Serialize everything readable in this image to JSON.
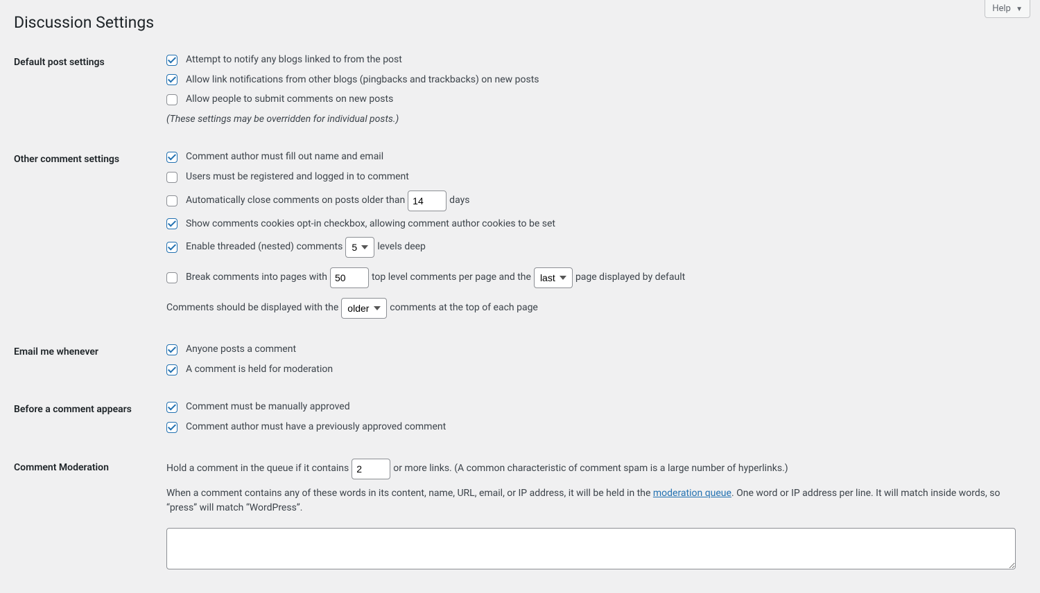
{
  "help": {
    "label": "Help"
  },
  "page": {
    "title": "Discussion Settings"
  },
  "sections": {
    "default_post": {
      "heading": "Default post settings",
      "opt1": {
        "checked": true,
        "label": "Attempt to notify any blogs linked to from the post"
      },
      "opt2": {
        "checked": true,
        "label": "Allow link notifications from other blogs (pingbacks and trackbacks) on new posts"
      },
      "opt3": {
        "checked": false,
        "label": "Allow people to submit comments on new posts"
      },
      "note": "(These settings may be overridden for individual posts.)"
    },
    "other_comments": {
      "heading": "Other comment settings",
      "opt1": {
        "checked": true,
        "label": "Comment author must fill out name and email"
      },
      "opt2": {
        "checked": false,
        "label": "Users must be registered and logged in to comment"
      },
      "opt3": {
        "checked": false,
        "label_pre": "Automatically close comments on posts older than",
        "value": "14",
        "label_post": "days"
      },
      "opt4": {
        "checked": true,
        "label": "Show comments cookies opt-in checkbox, allowing comment author cookies to be set"
      },
      "opt5": {
        "checked": true,
        "label_pre": "Enable threaded (nested) comments",
        "value": "5",
        "label_post": "levels deep"
      },
      "opt6": {
        "checked": false,
        "label_a": "Break comments into pages with",
        "per_page": "50",
        "label_b": "top level comments per page and the",
        "default_page": "last",
        "label_c": "page displayed by default"
      },
      "order": {
        "label_pre": "Comments should be displayed with the",
        "value": "older",
        "label_post": "comments at the top of each page"
      }
    },
    "email": {
      "heading": "Email me whenever",
      "opt1": {
        "checked": true,
        "label": "Anyone posts a comment"
      },
      "opt2": {
        "checked": true,
        "label": "A comment is held for moderation"
      }
    },
    "before_appears": {
      "heading": "Before a comment appears",
      "opt1": {
        "checked": true,
        "label": "Comment must be manually approved"
      },
      "opt2": {
        "checked": true,
        "label": "Comment author must have a previously approved comment"
      }
    },
    "moderation": {
      "heading": "Comment Moderation",
      "hold_pre": "Hold a comment in the queue if it contains",
      "hold_value": "2",
      "hold_post": "or more links. (A common characteristic of comment spam is a large number of hyperlinks.)",
      "desc_a": "When a comment contains any of these words in its content, name, URL, email, or IP address, it will be held in the ",
      "link": "moderation queue",
      "desc_b": ". One word or IP address per line. It will match inside words, so “press” will match “WordPress”."
    }
  }
}
